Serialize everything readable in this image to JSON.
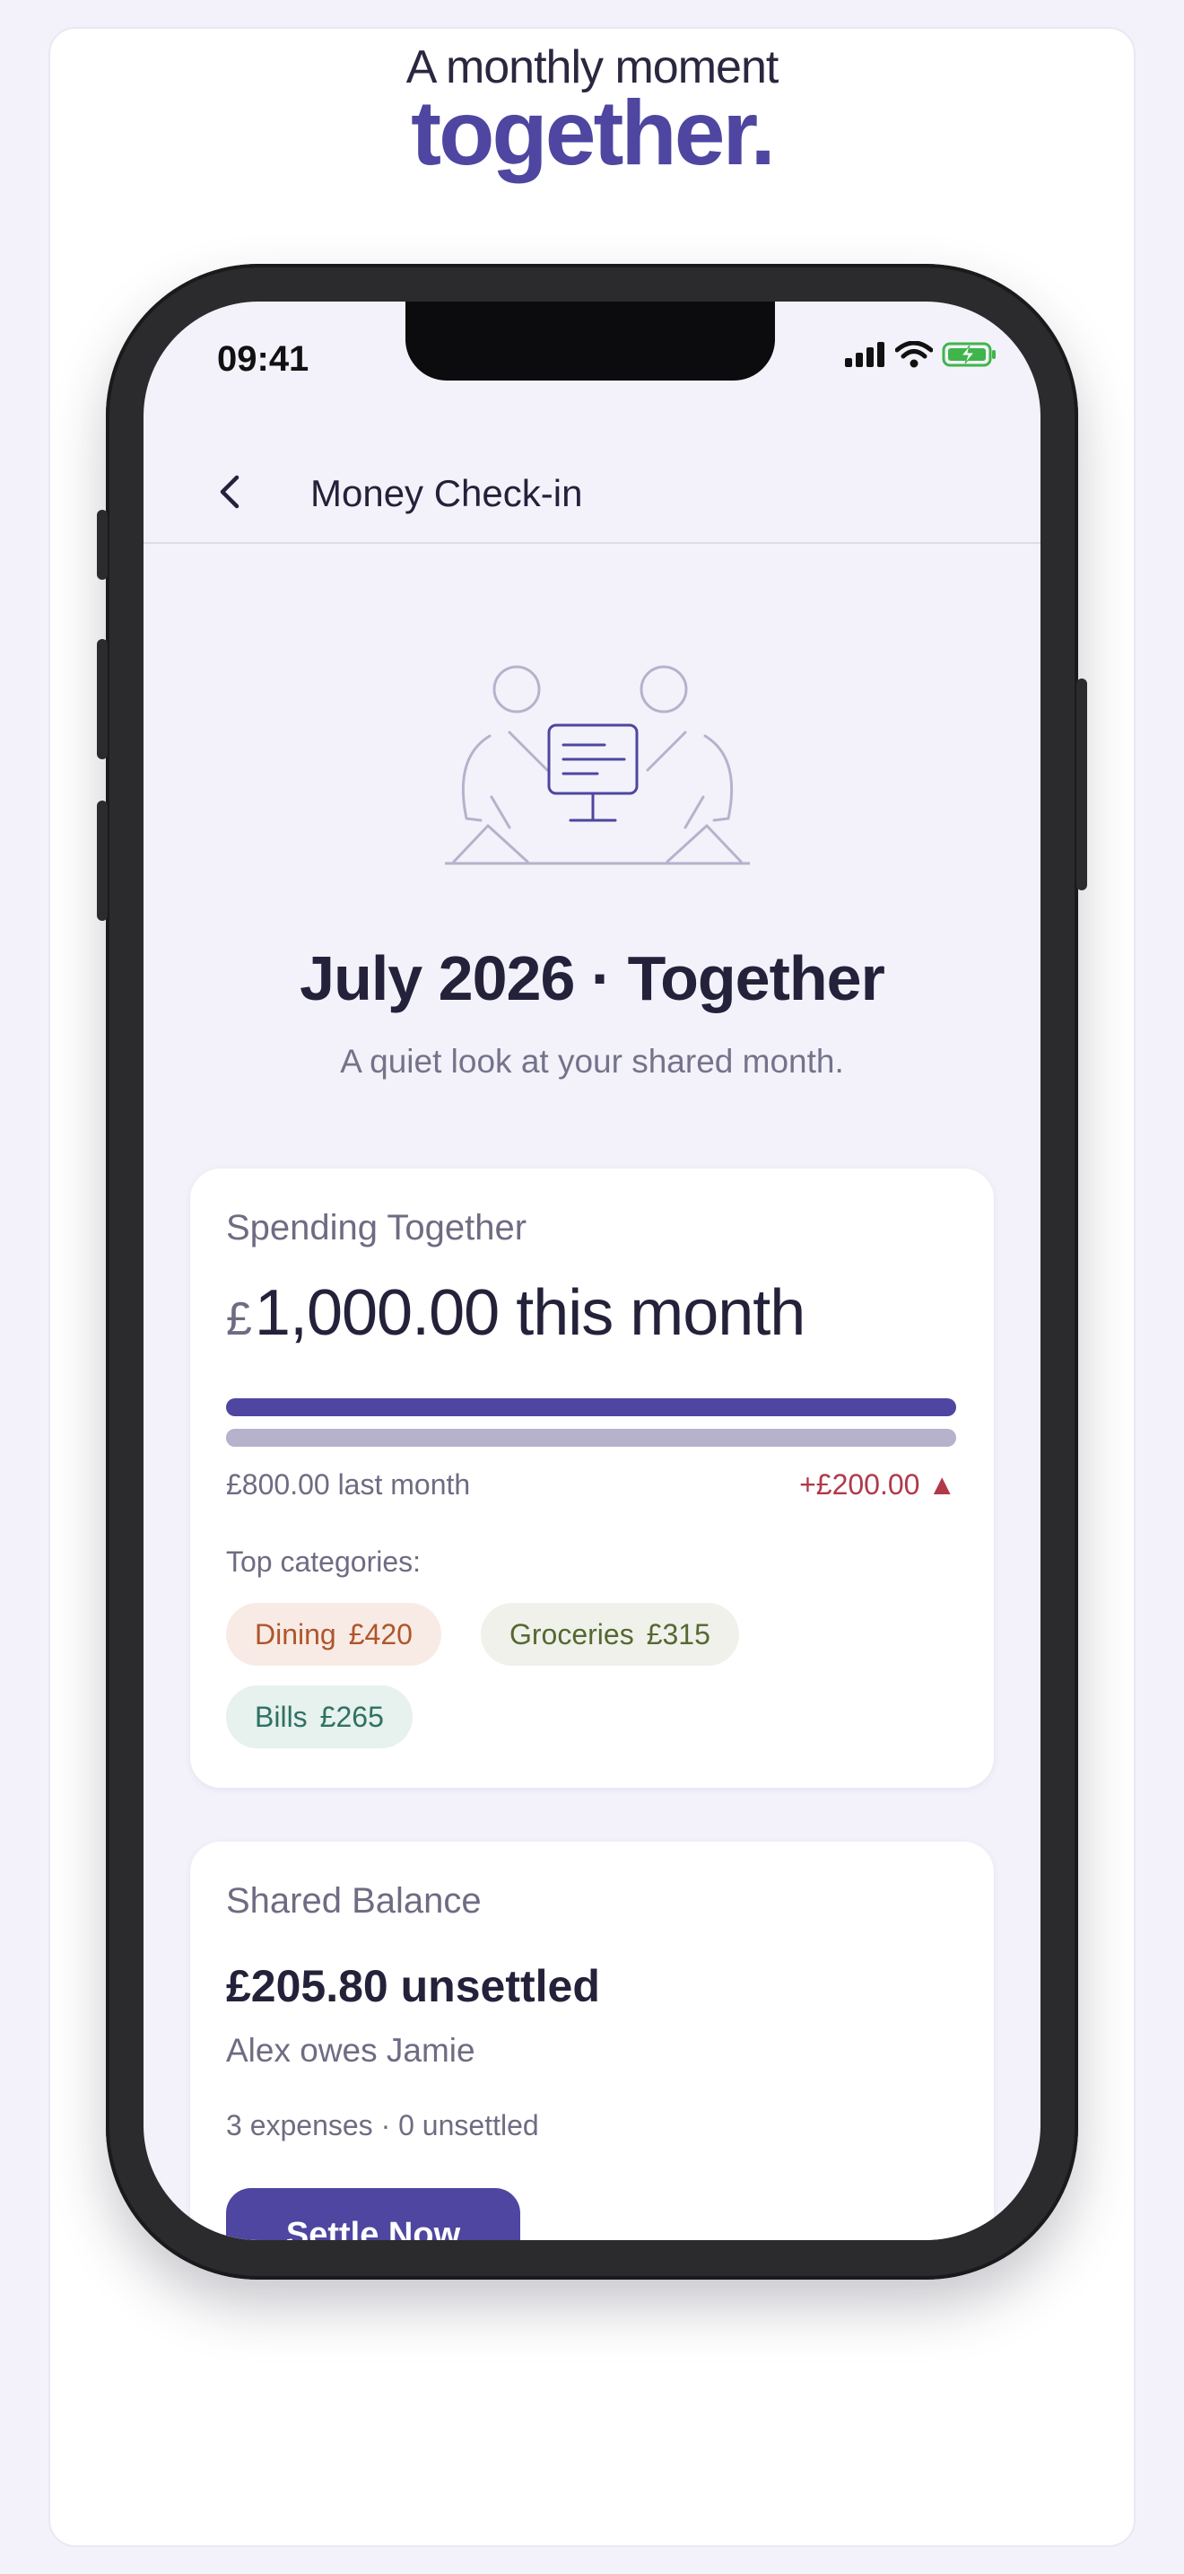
{
  "promo": {
    "headline_line1": "A monthly moment",
    "headline_line2": "together."
  },
  "status_bar": {
    "time": "09:41",
    "icons": [
      "signal-icon",
      "wifi-icon",
      "battery-charging-icon"
    ]
  },
  "nav": {
    "back_icon": "chevron-left-icon",
    "title": "Money Check-in"
  },
  "header": {
    "title": "July 2026 · Together",
    "subtitle": "A quiet look at your shared month."
  },
  "spending": {
    "label": "Spending Together",
    "currency_symbol": "£",
    "amount_text": "1,000.00 this month",
    "this_month_value": 1000.0,
    "last_month_value": 800.0,
    "last_month_text": "£800.00 last month",
    "delta_text": "+£200.00 ▲",
    "top_categories_label": "Top categories:",
    "categories": [
      {
        "name": "Dining",
        "amount": "£420",
        "bg": "#f8ebe6",
        "fg": "#b0552a"
      },
      {
        "name": "Groceries",
        "amount": "£315",
        "bg": "#eff1ea",
        "fg": "#566832"
      },
      {
        "name": "Bills",
        "amount": "£265",
        "bg": "#e7f1ee",
        "fg": "#2d7261"
      }
    ],
    "bar_colors": {
      "this_month": "#4e46a0",
      "last_month": "#b6b2cc"
    }
  },
  "balance": {
    "label": "Shared Balance",
    "amount_text": "£205.80 unsettled",
    "who_owes": "Alex owes Jamie",
    "meta": "3 expenses · 0 unsettled",
    "settle_button": "Settle Now"
  },
  "colors": {
    "accent": "#4e46a0",
    "negative": "#b0394a",
    "background": "#f3f2fa"
  }
}
